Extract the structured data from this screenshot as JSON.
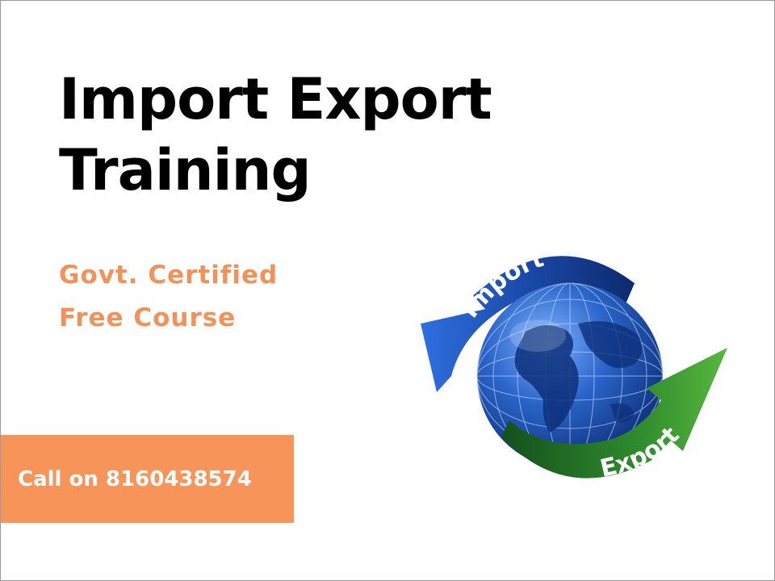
{
  "heading": {
    "line1": "Import Export",
    "line2": "Training"
  },
  "features": {
    "line1": "Govt. Certified",
    "line2": "Free Course"
  },
  "cta": {
    "label": "Call on 8160438574"
  },
  "emblem": {
    "import_label": "Import",
    "export_label": "Export",
    "import_color": "#1f4fa3",
    "export_color": "#3a8a2c",
    "globe_color": "#1d57b8"
  },
  "colors": {
    "accent": "#f7945a",
    "heading": "#000000"
  }
}
